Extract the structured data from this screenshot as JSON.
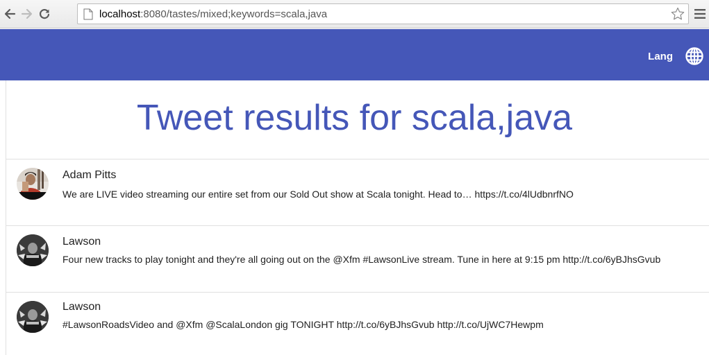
{
  "browser": {
    "url_host": "localhost",
    "url_path": ":8080/tastes/mixed;keywords=scala,java",
    "icons": [
      "back-arrow-icon",
      "forward-arrow-icon",
      "reload-icon",
      "page-icon",
      "star-icon",
      "menu-icon"
    ]
  },
  "toolbar": {
    "lang_label": "Lang",
    "globe_icon": "globe-icon",
    "background": "#4557b8"
  },
  "page": {
    "heading": "Tweet results for scala,java",
    "heading_color": "#4557b8"
  },
  "tweets": [
    {
      "author": "Adam Pitts",
      "text": "We are LIVE video streaming our entire set from our Sold Out show at Scala tonight. Head to… https://t.co/4lUdbnrfNO"
    },
    {
      "author": "Lawson",
      "text": "Four new tracks to play tonight and they're all going out on the @Xfm #LawsonLive stream. Tune in here at 9:15 pm http://t.co/6yBJhsGvub"
    },
    {
      "author": "Lawson",
      "text": "#LawsonRoadsVideo and @Xfm @ScalaLondon gig TONIGHT http://t.co/6yBJhsGvub http://t.co/UjWC7Hewpm"
    }
  ]
}
